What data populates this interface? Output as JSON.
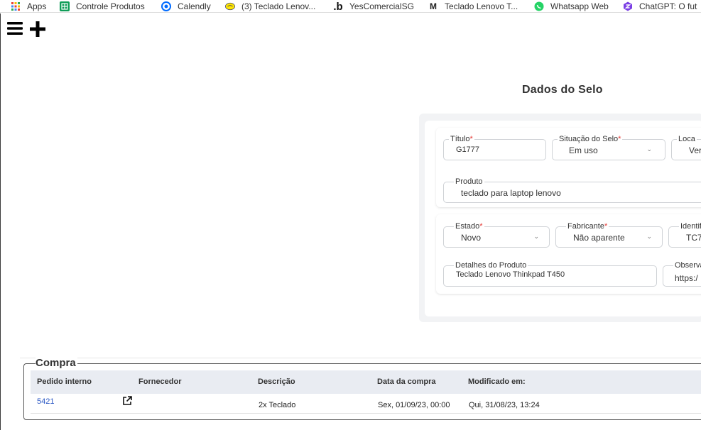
{
  "bookmarks": [
    {
      "label": "Apps",
      "icon": "apps-grid-icon",
      "color": "#4285f4"
    },
    {
      "label": "Controle Produtos",
      "icon": "google-sheets-icon",
      "color": "#0f9d58"
    },
    {
      "label": "Calendly",
      "icon": "calendly-icon",
      "color": "#006bff"
    },
    {
      "label": "(3) Teclado Lenov...",
      "icon": "mercado-livre-icon",
      "color": "#ffe600"
    },
    {
      "label": "YesComercialSG",
      "icon": "bling-icon",
      "color": "#111111"
    },
    {
      "label": "Teclado Lenovo T...",
      "icon": "mercado-m-icon",
      "color": "#222222"
    },
    {
      "label": "Whatsapp Web",
      "icon": "whatsapp-icon",
      "color": "#25d366"
    },
    {
      "label": "ChatGPT: O fut",
      "icon": "chatgpt-extension-icon",
      "color": "#7b3fe4"
    }
  ],
  "toolbar": {
    "menu_icon": "hamburger-menu-icon",
    "add_icon": "plus-icon"
  },
  "section": {
    "title": "Dados do Selo"
  },
  "form": {
    "titulo": {
      "label": "Título",
      "value": "G1777"
    },
    "situacao": {
      "label": "Situação do Selo",
      "value": "Em uso"
    },
    "local": {
      "label": "Loca",
      "value": "Ver"
    },
    "produto": {
      "label": "Produto",
      "value": "teclado para laptop lenovo"
    },
    "estado": {
      "label": "Estado",
      "value": "Novo"
    },
    "fabricante": {
      "label": "Fabricante",
      "value": "Não aparente"
    },
    "identificacao": {
      "label": "Identif",
      "value": "TC7"
    },
    "detalhes": {
      "label": "Detalhes do Produto",
      "value": "Teclado Lenovo Thinkpad T450"
    },
    "observacao": {
      "label": "Observa",
      "value": "https:/"
    },
    "required_mark": "*"
  },
  "compra": {
    "legend": "Compra",
    "columns": [
      "Pedido interno",
      "Fornecedor",
      "Descrição",
      "Data da compra",
      "Modificado em:"
    ],
    "rows": [
      {
        "pedido": "5421",
        "fornecedor": "",
        "descricao": "2x Teclado",
        "data_compra": "Sex, 01/09/23, 00:00",
        "modificado": "Qui, 31/08/23, 13:24"
      }
    ]
  },
  "colors": {
    "required": "#e53935",
    "link": "#2a57c4",
    "table_header": "#e9ecf2",
    "panel_bg": "#f2f3f5"
  }
}
